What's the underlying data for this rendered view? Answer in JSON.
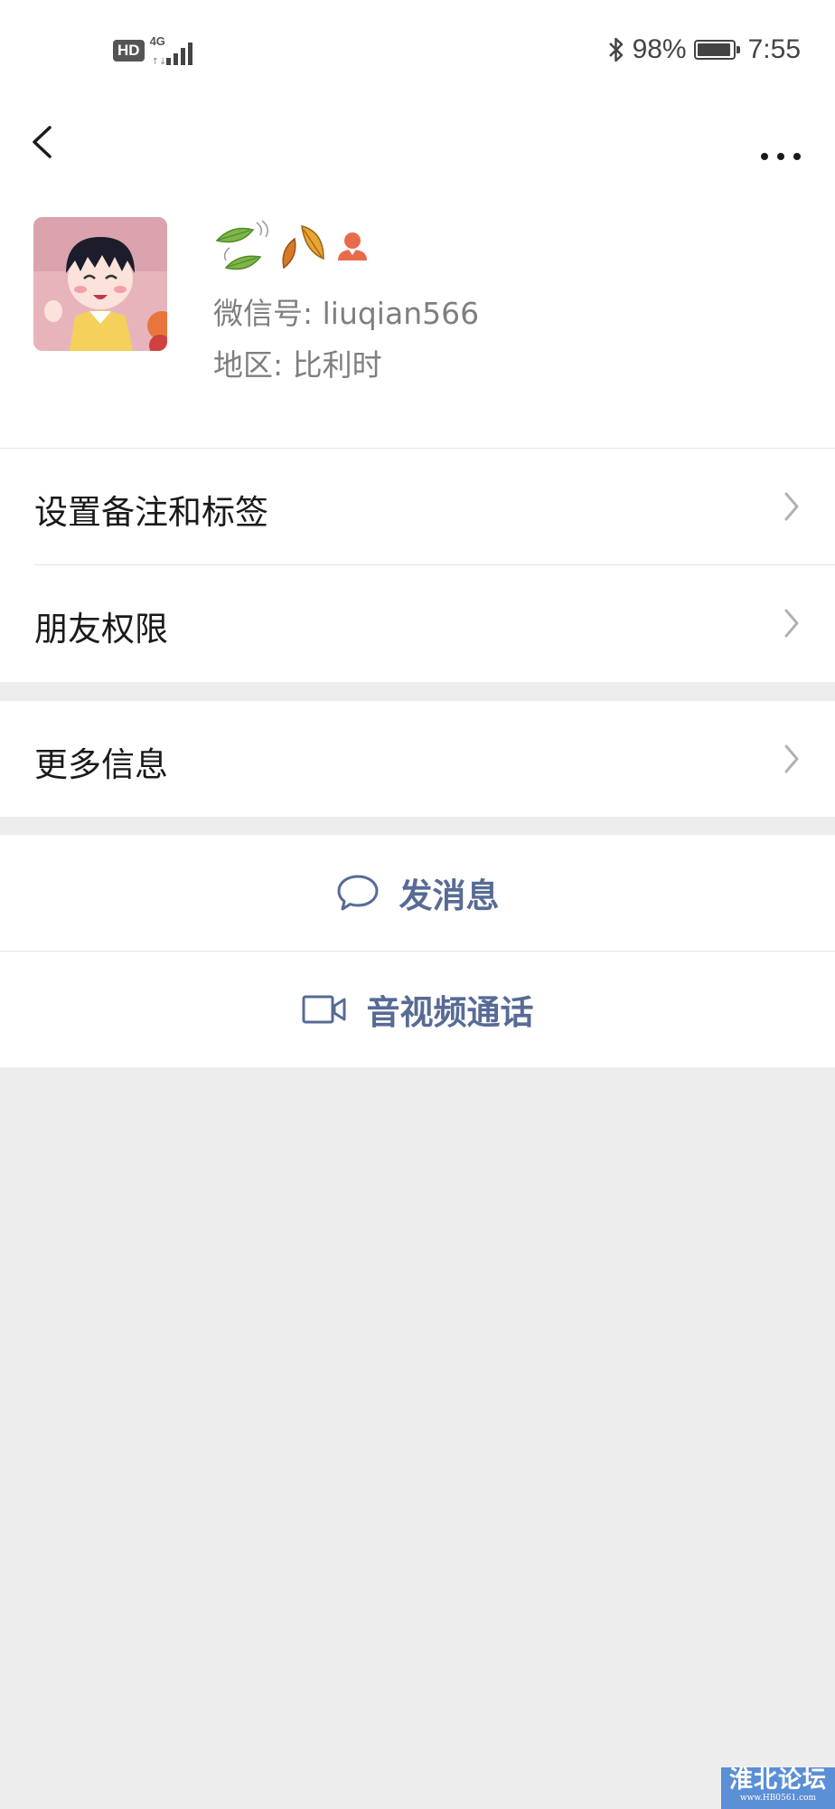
{
  "status_bar": {
    "hd": "HD",
    "network": "4G",
    "battery_percent": "98%",
    "battery_level": 0.98,
    "time": "7:55"
  },
  "nav": {
    "back_icon": "chevron-left-icon",
    "more_icon": "more-horizontal-icon"
  },
  "profile": {
    "nickname_icons": [
      "leaf-fluttering-icon",
      "fallen-leaf-icon",
      "person-icon"
    ],
    "wechat_id": "微信号: liuqian566",
    "region": "地区: 比利时"
  },
  "list": {
    "remarks_tags": "设置备注和标签",
    "friend_permissions": "朋友权限",
    "more_info": "更多信息"
  },
  "actions": {
    "send_message": "发消息",
    "video_call": "音视频通话"
  },
  "watermark": {
    "title": "淮北论坛",
    "url": "www.HB0561.com"
  },
  "colors": {
    "link_blue": "#576b95",
    "background": "#ededed",
    "secondary_text": "#7f7f7f"
  }
}
